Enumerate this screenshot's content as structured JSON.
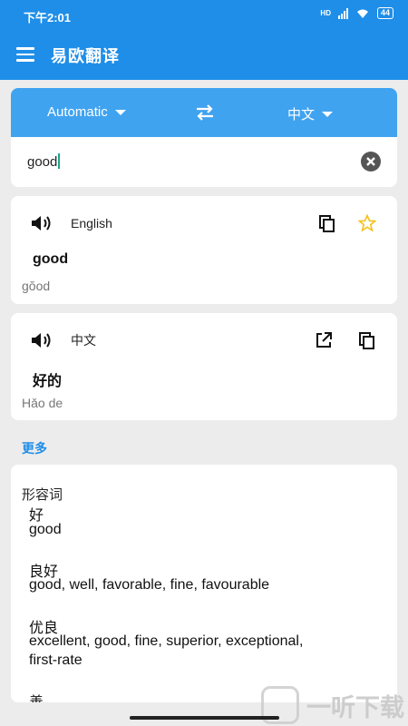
{
  "status_bar": {
    "time": "下午2:01",
    "network": "HD",
    "battery": "44"
  },
  "app": {
    "title": "易欧翻译"
  },
  "language": {
    "source": "Automatic",
    "target": "中文"
  },
  "input": {
    "value": "good"
  },
  "source_card": {
    "language": "English",
    "word": "good",
    "phonetic": "gŏod"
  },
  "target_card": {
    "language": "中文",
    "word": "好的",
    "phonetic": "Hǎo de"
  },
  "more_label": "更多",
  "dictionary": {
    "part_of_speech": "形容词",
    "lines": [
      "好",
      "good",
      "良好",
      "good, well, favorable, fine, favourable",
      "优良",
      "excellent, good, fine, superior, exceptional,",
      "first-rate",
      "善"
    ]
  },
  "watermark": "一听下载",
  "colors": {
    "primary": "#1f8ee8",
    "language_bar": "#40a3f0",
    "star": "#f2c21a"
  }
}
